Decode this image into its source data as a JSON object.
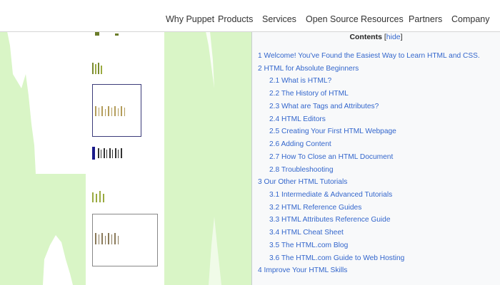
{
  "nav": {
    "items": [
      {
        "label": "Why Puppet"
      },
      {
        "label": "Products"
      },
      {
        "label": "Services"
      },
      {
        "label": "Open Source"
      },
      {
        "label": "Resources"
      },
      {
        "label": "Partners"
      },
      {
        "label": "Company"
      }
    ]
  },
  "toc": {
    "title": "Contents",
    "bracket_open": "[",
    "hide_label": "hide",
    "bracket_close": "]",
    "items": [
      {
        "number": "1",
        "text": "Welcome! You've Found the Easiest Way to Learn HTML and CSS."
      },
      {
        "number": "2",
        "text": "HTML for Absolute Beginners"
      },
      {
        "number": "2.1",
        "text": "What is HTML?"
      },
      {
        "number": "2.2",
        "text": "The History of HTML"
      },
      {
        "number": "2.3",
        "text": "What are Tags and Attributes?"
      },
      {
        "number": "2.4",
        "text": "HTML Editors"
      },
      {
        "number": "2.5",
        "text": "Creating Your First HTML Webpage"
      },
      {
        "number": "2.6",
        "text": "Adding Content"
      },
      {
        "number": "2.7",
        "text": "How To Close an HTML Document"
      },
      {
        "number": "2.8",
        "text": "Troubleshooting"
      },
      {
        "number": "3",
        "text": "Our Other HTML Tutorials"
      },
      {
        "number": "3.1",
        "text": "Intermediate & Advanced Tutorials"
      },
      {
        "number": "3.2",
        "text": "HTML Reference Guides"
      },
      {
        "number": "3.3",
        "text": "HTML Attributes Reference Guide"
      },
      {
        "number": "3.4",
        "text": "HTML Cheat Sheet"
      },
      {
        "number": "3.5",
        "text": "The HTML.com Blog"
      },
      {
        "number": "3.6",
        "text": "The HTML.com Guide to Web Hosting"
      },
      {
        "number": "4",
        "text": "Improve Your HTML Skills"
      }
    ]
  },
  "colors": {
    "link": "#3366cc",
    "panel_bg": "#f8f9fa",
    "green_bg": "#d9f5c6"
  }
}
